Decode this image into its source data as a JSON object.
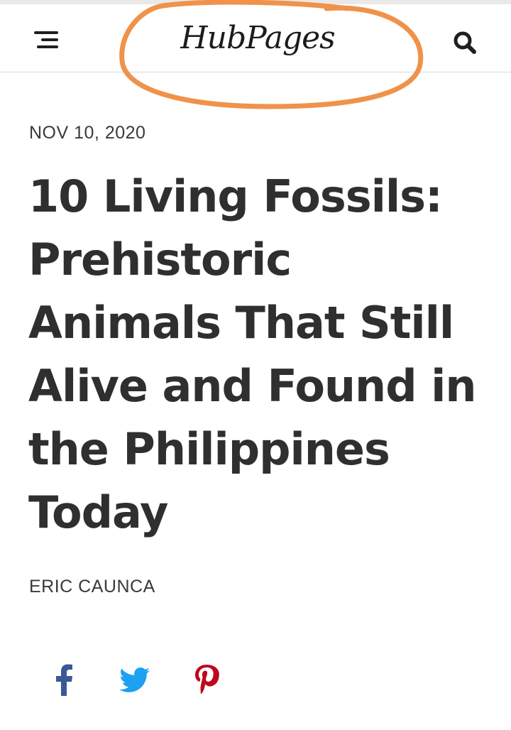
{
  "header": {
    "logo_text": "HubPages",
    "menu_icon": "hamburger-menu-icon",
    "search_icon": "search-icon",
    "highlight_color": "#F0924A"
  },
  "article": {
    "date": "NOV 10, 2020",
    "title": "10 Living Fossils: Prehistoric Animals That Still Alive and Found in the Philippines Today",
    "author": "ERIC CAUNCA"
  },
  "share": {
    "facebook": {
      "icon": "facebook-icon",
      "color": "#3b5998"
    },
    "twitter": {
      "icon": "twitter-icon",
      "color": "#1da1f2"
    },
    "pinterest": {
      "icon": "pinterest-icon",
      "color": "#bd081c"
    }
  }
}
